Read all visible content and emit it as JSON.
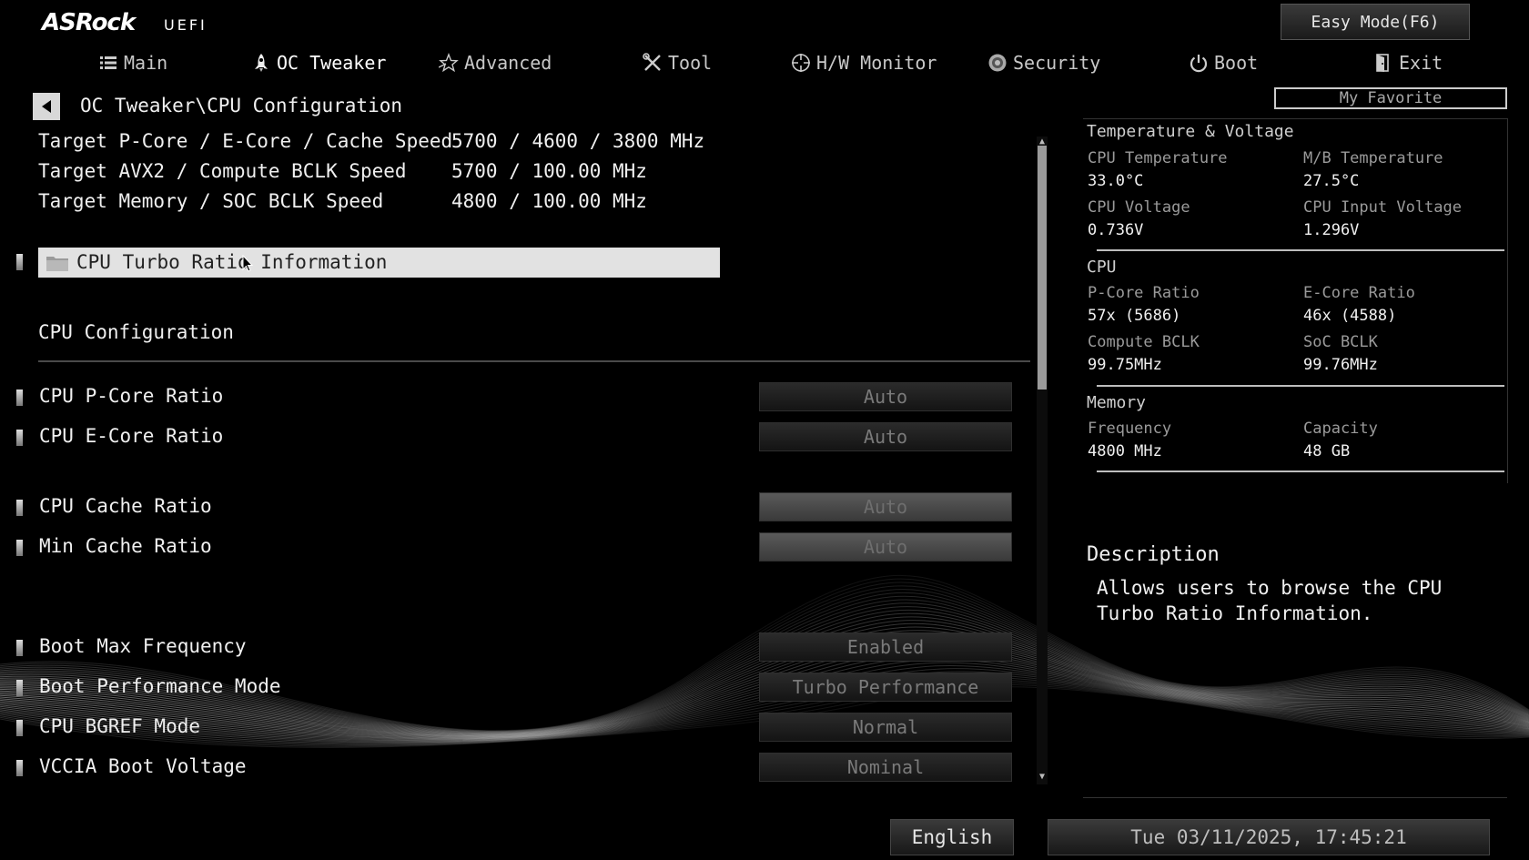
{
  "header": {
    "brand": "ASRock",
    "brand_sub": "UEFI",
    "easy_mode": "Easy Mode(F6)",
    "favorite": "My Favorite"
  },
  "tabs": [
    {
      "label": "Main",
      "icon": "list-icon"
    },
    {
      "label": "OC Tweaker",
      "icon": "rocket-icon",
      "active": true
    },
    {
      "label": "Advanced",
      "icon": "star-icon"
    },
    {
      "label": "Tool",
      "icon": "tools-icon"
    },
    {
      "label": "H/W Monitor",
      "icon": "crosshair-icon"
    },
    {
      "label": "Security",
      "icon": "shield-icon"
    },
    {
      "label": "Boot",
      "icon": "power-icon"
    },
    {
      "label": "Exit",
      "icon": "door-icon"
    }
  ],
  "breadcrumb": "OC Tweaker\\CPU Configuration",
  "info": [
    {
      "label": "Target P-Core / E-Core / Cache Speed",
      "value": "5700 / 4600 / 3800 MHz"
    },
    {
      "label": "Target AVX2 / Compute BCLK Speed",
      "value": "5700 / 100.00 MHz"
    },
    {
      "label": "Target Memory / SOC BCLK Speed",
      "value": "4800 / 100.00 MHz"
    }
  ],
  "selected_item": "CPU Turbo Ratio Information",
  "section_title": "CPU Configuration",
  "settings": [
    {
      "label": "CPU P-Core Ratio",
      "value": "Auto"
    },
    {
      "label": "CPU E-Core Ratio",
      "value": "Auto"
    },
    {
      "label": "CPU Cache  Ratio",
      "value": "Auto"
    },
    {
      "label": "Min Cache  Ratio",
      "value": "Auto"
    },
    {
      "label": "Boot Max Frequency",
      "value": "Enabled"
    },
    {
      "label": "Boot Performance Mode",
      "value": "Turbo Performance"
    },
    {
      "label": "CPU BGREF Mode",
      "value": "Normal"
    },
    {
      "label": "VCCIA Boot Voltage",
      "value": "Nominal"
    }
  ],
  "monitor": {
    "temp_voltage": {
      "title": "Temperature & Voltage",
      "cpu_temp_label": "CPU Temperature",
      "cpu_temp": "33.0°C",
      "mb_temp_label": "M/B Temperature",
      "mb_temp": "27.5°C",
      "cpu_volt_label": "CPU Voltage",
      "cpu_volt": "0.736V",
      "cpu_in_volt_label": "CPU Input Voltage",
      "cpu_in_volt": "1.296V"
    },
    "cpu": {
      "title": "CPU",
      "pcore_label": "P-Core Ratio",
      "pcore": "57x (5686)",
      "ecore_label": "E-Core Ratio",
      "ecore": "46x (4588)",
      "compute_label": "Compute BCLK",
      "compute": "99.75MHz",
      "soc_label": "SoC BCLK",
      "soc": "99.76MHz"
    },
    "memory": {
      "title": "Memory",
      "freq_label": "Frequency",
      "freq": "4800 MHz",
      "cap_label": "Capacity",
      "cap": "48 GB"
    }
  },
  "description": {
    "title": "Description",
    "text": "Allows users to browse the CPU Turbo Ratio Information."
  },
  "footer": {
    "language": "English",
    "datetime": "Tue 03/11/2025, 17:45:21"
  }
}
